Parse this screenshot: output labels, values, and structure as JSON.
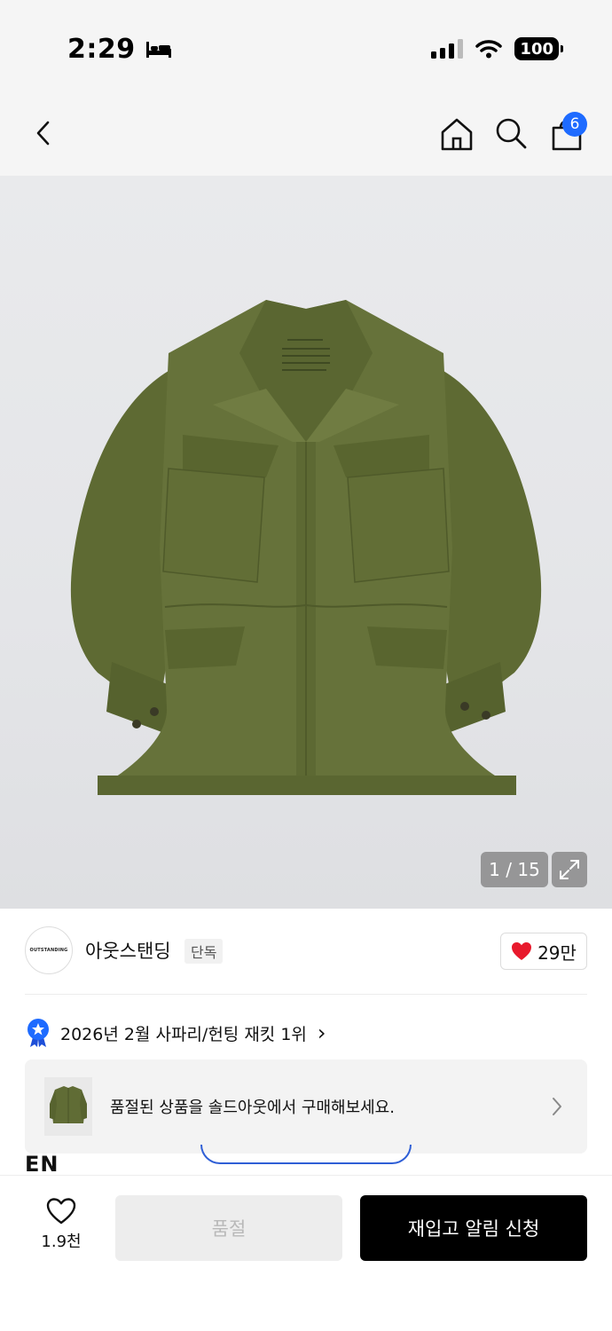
{
  "status_bar": {
    "time": "2:29",
    "battery": "100",
    "sleep_icon": "bed-icon",
    "signal_icon": "cellular-signal-icon",
    "wifi_icon": "wifi-icon"
  },
  "nav": {
    "back_icon": "chevron-left-icon",
    "home_icon": "home-icon",
    "search_icon": "search-icon",
    "bag_icon": "shopping-bag-icon",
    "bag_count": "6",
    "badge_color": "#1e6bff"
  },
  "gallery": {
    "counter": "1 / 15",
    "expand_icon": "expand-icon",
    "image_subject": "olive-field-jacket"
  },
  "brand": {
    "logo_text": "OUTSTANDING",
    "name": "아웃스탠딩",
    "tag": "단독",
    "like_count": "29만",
    "heart_color": "#e8192c"
  },
  "ranking": {
    "text": "2026년 2월 사파리/헌팅 재킷 1위",
    "badge_icon": "ranking-medal-icon",
    "chevron": "›",
    "badge_color": "#1e6bff"
  },
  "soldout_card": {
    "text": "품절된 상품을 솔드아웃에서 구매해보세요."
  },
  "partial": {
    "text": "EN"
  },
  "bottom_bar": {
    "wish_count": "1.9천",
    "soldout_label": "품절",
    "restock_label": "재입고 알림 신청"
  }
}
